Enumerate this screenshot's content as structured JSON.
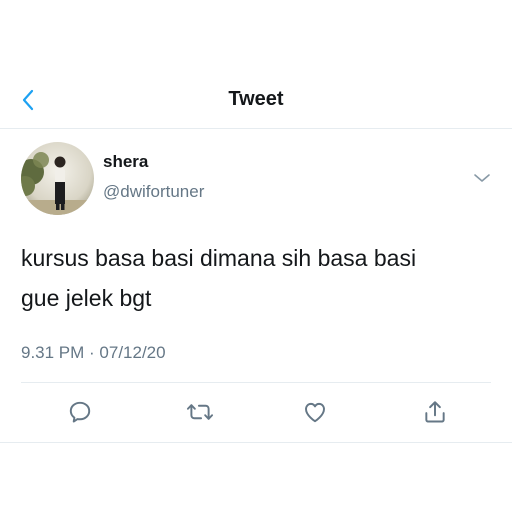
{
  "header": {
    "title": "Tweet",
    "back_icon": "chevron-left-icon"
  },
  "tweet": {
    "author_name": "shera",
    "author_handle": "@dwifortuner",
    "text_line1": "kursus basa basi dimana sih basa basi",
    "text_line2": "gue jelek bgt",
    "timestamp": "9.31 PM · 07/12/20"
  },
  "actions": [
    {
      "name": "reply",
      "icon": "reply-icon"
    },
    {
      "name": "retweet",
      "icon": "retweet-icon"
    },
    {
      "name": "like",
      "icon": "heart-icon"
    },
    {
      "name": "share",
      "icon": "share-icon"
    }
  ],
  "colors": {
    "accent": "#1da1f2",
    "text_primary": "#14171a",
    "text_secondary": "#657786",
    "divider": "#e6ecf0"
  }
}
